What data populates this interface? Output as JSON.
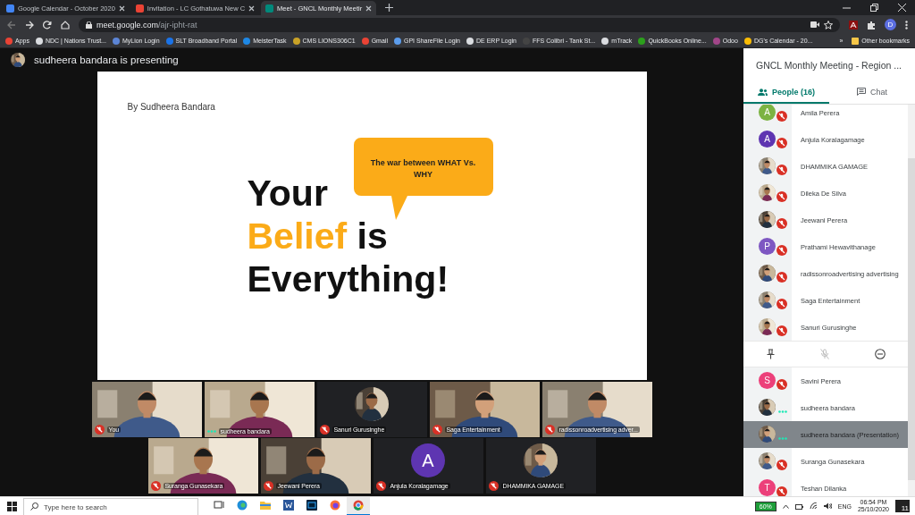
{
  "browser": {
    "tabs": [
      {
        "title": "Google Calendar - October 2020",
        "selected": false,
        "color": "#4285f4"
      },
      {
        "title": "Invitation - LC Gothatuwa New C",
        "selected": false,
        "color": "#ea4335"
      },
      {
        "title": "Meet - GNCL Monthly Meetir",
        "selected": true,
        "color": "#00897b"
      }
    ],
    "address": {
      "host": "meet.google.com",
      "path": "/ajr-ipht-rat"
    },
    "profile": "D",
    "bookmarks": [
      {
        "label": "Apps",
        "color": "#ea4335"
      },
      {
        "label": "NDC | Nations Trust...",
        "color": "#dadce0"
      },
      {
        "label": "MyLion Login",
        "color": "#5c85d6"
      },
      {
        "label": "SLT Broadband Portal",
        "color": "#1a73e8"
      },
      {
        "label": "MeisterTask",
        "color": "#1e88e5"
      },
      {
        "label": "CMS LIONS306C1",
        "color": "#c9a227"
      },
      {
        "label": "Gmail",
        "color": "#ea4335"
      },
      {
        "label": "GPI ShareFile Login",
        "color": "#5c9ded"
      },
      {
        "label": "DE ERP Login",
        "color": "#dadce0"
      },
      {
        "label": "FFS Colibri - Tank St...",
        "color": "#444444"
      },
      {
        "label": "mTrack",
        "color": "#dadce0"
      },
      {
        "label": "QuickBooks Online...",
        "color": "#2ca01c"
      },
      {
        "label": "Odoo",
        "color": "#a24689"
      },
      {
        "label": "DG's Calendar - 20...",
        "color": "#fbbc04"
      }
    ],
    "more": "»",
    "other_bookmarks": "Other bookmarks"
  },
  "presenting": "sudheera bandara is presenting",
  "slide": {
    "byline": "By Sudheera Bandara",
    "bubble": "The war between WHAT Vs. WHY",
    "headline": [
      [
        {
          "text": "Your",
          "accent": false
        }
      ],
      [
        {
          "text": "Belief",
          "accent": true
        },
        {
          "text": " is",
          "accent": false
        }
      ],
      [
        {
          "text": "Everything!",
          "accent": false
        }
      ]
    ]
  },
  "tiles": [
    [
      {
        "name": "You",
        "kind": "video",
        "muted": true
      },
      {
        "name": "sudheera bandara",
        "kind": "video",
        "muted": false
      },
      {
        "name": "Sanuri Gurusinghe",
        "muted": true
      },
      {
        "name": "Saga Entertainment",
        "kind": "video",
        "muted": true
      },
      {
        "name": "radissonroadvertising adver...",
        "kind": "video",
        "muted": true
      }
    ],
    [
      {
        "name": "Suranga Gunasekara",
        "kind": "video",
        "muted": true
      },
      {
        "name": "Jeewani Perera",
        "kind": "video",
        "muted": true
      },
      {
        "name": "Anjula Koralagamage",
        "kind": "letter",
        "initial": "A",
        "color": "#5e35b1",
        "muted": true
      },
      {
        "name": "DHAMMIKA GAMAGE",
        "muted": true
      }
    ]
  ],
  "panel": {
    "title": "GNCL Monthly Meeting - Region ...",
    "tabs": [
      {
        "label": "People (16)",
        "selected": true
      },
      {
        "label": "Chat",
        "selected": false
      }
    ],
    "participants": [
      {
        "name": "Amila Perera",
        "kind": "letter",
        "initial": "A",
        "color": "#7cb342",
        "muted": true,
        "selected": false,
        "expanded": false
      },
      {
        "name": "Anjula Koralagamage",
        "kind": "letter",
        "initial": "A",
        "color": "#5e35b1",
        "muted": true,
        "selected": false,
        "expanded": false
      },
      {
        "name": "DHAMMIKA GAMAGE",
        "muted": true,
        "selected": false,
        "expanded": false
      },
      {
        "name": "Dileka De Silva",
        "muted": true,
        "selected": false,
        "expanded": false
      },
      {
        "name": "Jeewani Perera",
        "muted": true,
        "selected": false,
        "expanded": false
      },
      {
        "name": "Prathami Hewavithanage",
        "kind": "letter",
        "initial": "P",
        "color": "#7e57c2",
        "muted": true,
        "selected": false,
        "expanded": false
      },
      {
        "name": "radissonroadvertising advertising",
        "muted": true,
        "selected": false,
        "expanded": false
      },
      {
        "name": "Saga Entertainment",
        "muted": true,
        "selected": false,
        "expanded": false
      },
      {
        "name": "Sanuri Gurusinghe",
        "muted": true,
        "selected": false,
        "expanded": true
      },
      {
        "name": "Savini Perera",
        "kind": "letter",
        "initial": "S",
        "color": "#ec407a",
        "muted": true,
        "selected": false,
        "expanded": false
      },
      {
        "name": "sudheera bandara",
        "muted": false,
        "selected": false,
        "expanded": false
      },
      {
        "name": "sudheera bandara (Presentation)",
        "muted": false,
        "selected": true,
        "expanded": false
      },
      {
        "name": "Suranga Gunasekara",
        "muted": true,
        "selected": false,
        "expanded": false
      },
      {
        "name": "Teshan Dilanka",
        "kind": "letter",
        "initial": "T",
        "color": "#ec407a",
        "muted": true,
        "selected": false,
        "expanded": false
      }
    ]
  },
  "taskbar": {
    "search_placeholder": "Type here to search",
    "apps": [
      {
        "kind": "taskview",
        "selected": false
      },
      {
        "kind": "edge",
        "selected": false
      },
      {
        "kind": "folder",
        "selected": false
      },
      {
        "kind": "word",
        "selected": false
      },
      {
        "kind": "photoshop",
        "selected": false
      },
      {
        "kind": "firefox",
        "selected": false
      },
      {
        "kind": "chrome",
        "selected": true
      }
    ],
    "battery": "60%",
    "language": "ENG",
    "time": "06:54 PM",
    "date": "25/10/2020",
    "notifications": "11"
  }
}
